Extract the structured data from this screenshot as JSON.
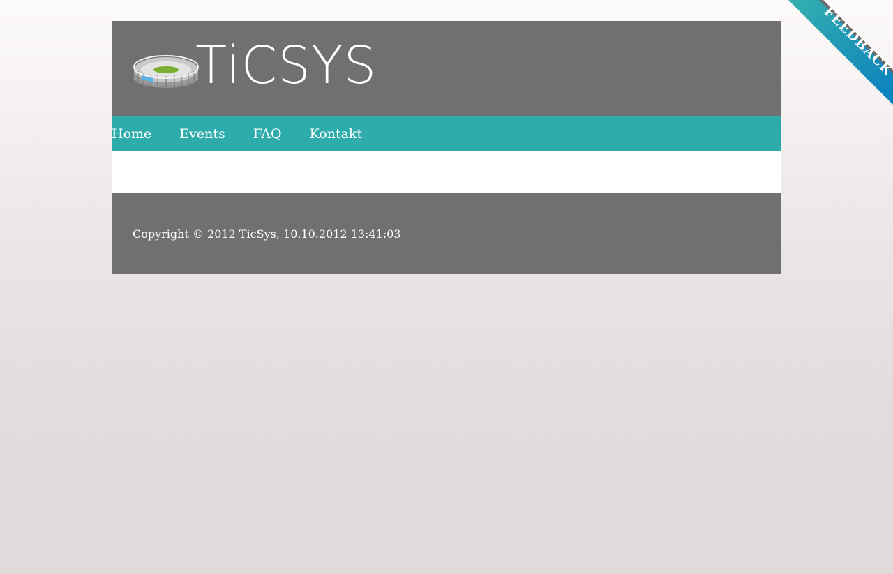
{
  "header": {
    "logo_text": "TiCSYS",
    "logo_icon": "stadium-icon",
    "background_color": "#707070"
  },
  "nav": {
    "background_color": "#2eacac",
    "items": [
      {
        "label": "Home"
      },
      {
        "label": "Events"
      },
      {
        "label": "FAQ"
      },
      {
        "label": "Kontakt"
      }
    ]
  },
  "footer": {
    "copyright": "Copyright © 2012 TicSys, 10.10.2012 13:41:03"
  },
  "feedback": {
    "label": "FEEDBACK",
    "color": "#2eacac"
  }
}
